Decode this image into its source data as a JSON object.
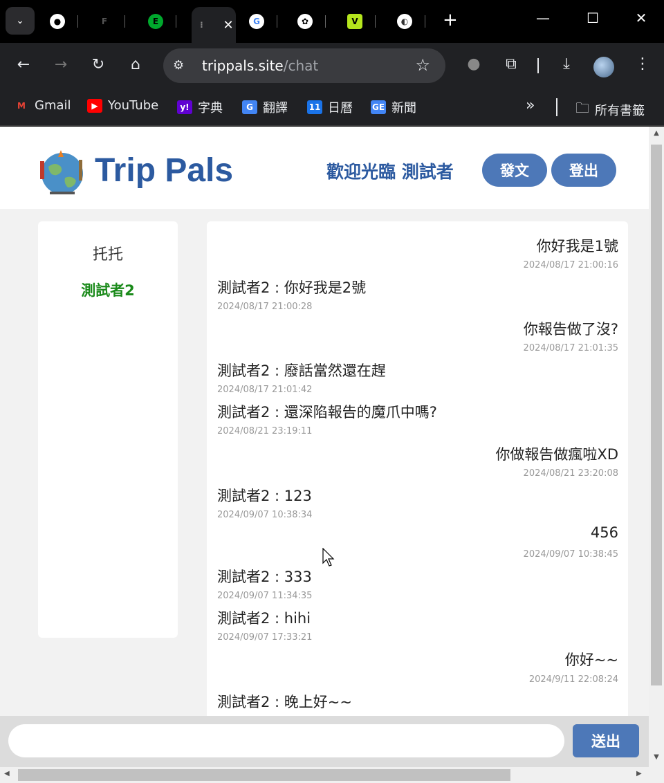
{
  "browser": {
    "url_domain": "trippals.site",
    "url_path": "/chat",
    "bookmarks": [
      {
        "label": "Gmail",
        "icon": "gmail-icon",
        "color": "#ea4335"
      },
      {
        "label": "YouTube",
        "icon": "youtube-icon",
        "color": "#ff0000"
      },
      {
        "label": "字典",
        "icon": "yahoo-icon",
        "color": "#6001d2"
      },
      {
        "label": "翻譯",
        "icon": "translate-icon",
        "color": "#4285f4"
      },
      {
        "label": "日曆",
        "icon": "calendar-icon",
        "color": "#1a73e8"
      },
      {
        "label": "新聞",
        "icon": "news-icon",
        "color": "#4285f4"
      }
    ],
    "bookmarks_folder": "所有書籤",
    "tabs": [
      {
        "icon": "github-icon"
      },
      {
        "icon": "figma-icon"
      },
      {
        "icon": "evernote-icon"
      },
      {
        "icon": "active-tab-icon"
      },
      {
        "icon": "google-icon"
      },
      {
        "icon": "openai-icon"
      },
      {
        "icon": "v-icon"
      },
      {
        "icon": "app-icon"
      }
    ]
  },
  "site": {
    "brand": "Trip Pals",
    "welcome": "歡迎光臨 測試者",
    "post_button": "發文",
    "logout_button": "登出",
    "accent_color": "#2c5aa0"
  },
  "sidebar": {
    "users": [
      {
        "name": "托托",
        "active": false
      },
      {
        "name": "測試者2",
        "active": true
      }
    ]
  },
  "chat": {
    "messages": [
      {
        "side": "right",
        "text": "你好我是1號",
        "time": "2024/08/17 21:00:16"
      },
      {
        "side": "left",
        "text": "測試者2 : 你好我是2號",
        "time": "2024/08/17 21:00:28"
      },
      {
        "side": "right",
        "text": "你報告做了沒?",
        "time": "2024/08/17 21:01:35"
      },
      {
        "side": "left",
        "text": "測試者2 : 廢話當然還在趕",
        "time": "2024/08/17 21:01:42"
      },
      {
        "side": "left",
        "text": "測試者2 : 還深陷報告的魔爪中嗎?",
        "time": "2024/08/21 23:19:11"
      },
      {
        "side": "right",
        "text": "你做報告做瘋啦XD",
        "time": "2024/08/21 23:20:08"
      },
      {
        "side": "left",
        "text": "測試者2 : 123",
        "time": "2024/09/07 10:38:34"
      },
      {
        "side": "right",
        "text": "456",
        "time": "2024/09/07 10:38:45"
      },
      {
        "side": "left",
        "text": "測試者2 : 333",
        "time": "2024/09/07 11:34:35"
      },
      {
        "side": "left",
        "text": "測試者2 : hihi",
        "time": "2024/09/07 17:33:21"
      },
      {
        "side": "right",
        "text": "你好~~",
        "time": "2024/9/11 22:08:24"
      },
      {
        "side": "left",
        "text": "測試者2 : 晚上好~~",
        "time": ""
      }
    ],
    "input_value": "",
    "input_placeholder": "",
    "send_button": "送出"
  }
}
